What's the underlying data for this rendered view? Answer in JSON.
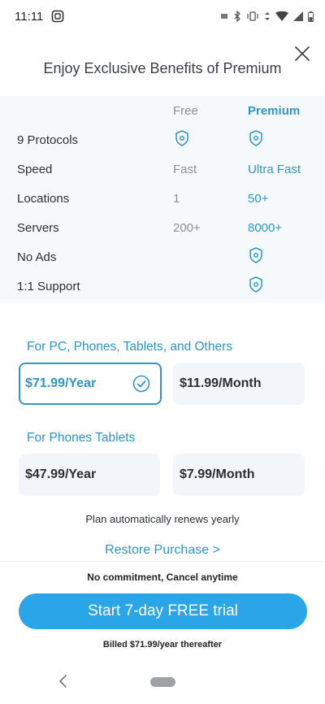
{
  "status_bar": {
    "time": "11:11"
  },
  "header": {
    "title": "Enjoy Exclusive Benefits of Premium"
  },
  "table": {
    "col_free": "Free",
    "col_premium": "Premium",
    "rows": [
      {
        "feature": "9 Protocols",
        "free": "",
        "premium": ""
      },
      {
        "feature": "Speed",
        "free": "Fast",
        "premium": "Ultra Fast"
      },
      {
        "feature": "Locations",
        "free": "1",
        "premium": "50+"
      },
      {
        "feature": "Servers",
        "free": "200+",
        "premium": "8000+"
      },
      {
        "feature": "No Ads",
        "free": "",
        "premium": ""
      },
      {
        "feature": "1:1 Support",
        "free": "",
        "premium": ""
      }
    ]
  },
  "plans": {
    "pc_title": "For PC, Phones, Tablets, and Others",
    "pc_year": "$71.99/Year",
    "pc_month": "$11.99/Month",
    "phone_title": "For Phones Tablets",
    "phone_year": "$47.99/Year",
    "phone_month": "$7.99/Month"
  },
  "renew_note": "Plan automatically renews yearly",
  "restore_label": "Restore Purchase >",
  "no_commitment": "No commitment, Cancel anytime",
  "cta_label": "Start 7-day FREE trial",
  "billed_note": "Billed $71.99/year thereafter",
  "colors": {
    "accent": "#2e97c7",
    "cta": "#2aa6e8",
    "table_bg": "#f6f9fc"
  }
}
